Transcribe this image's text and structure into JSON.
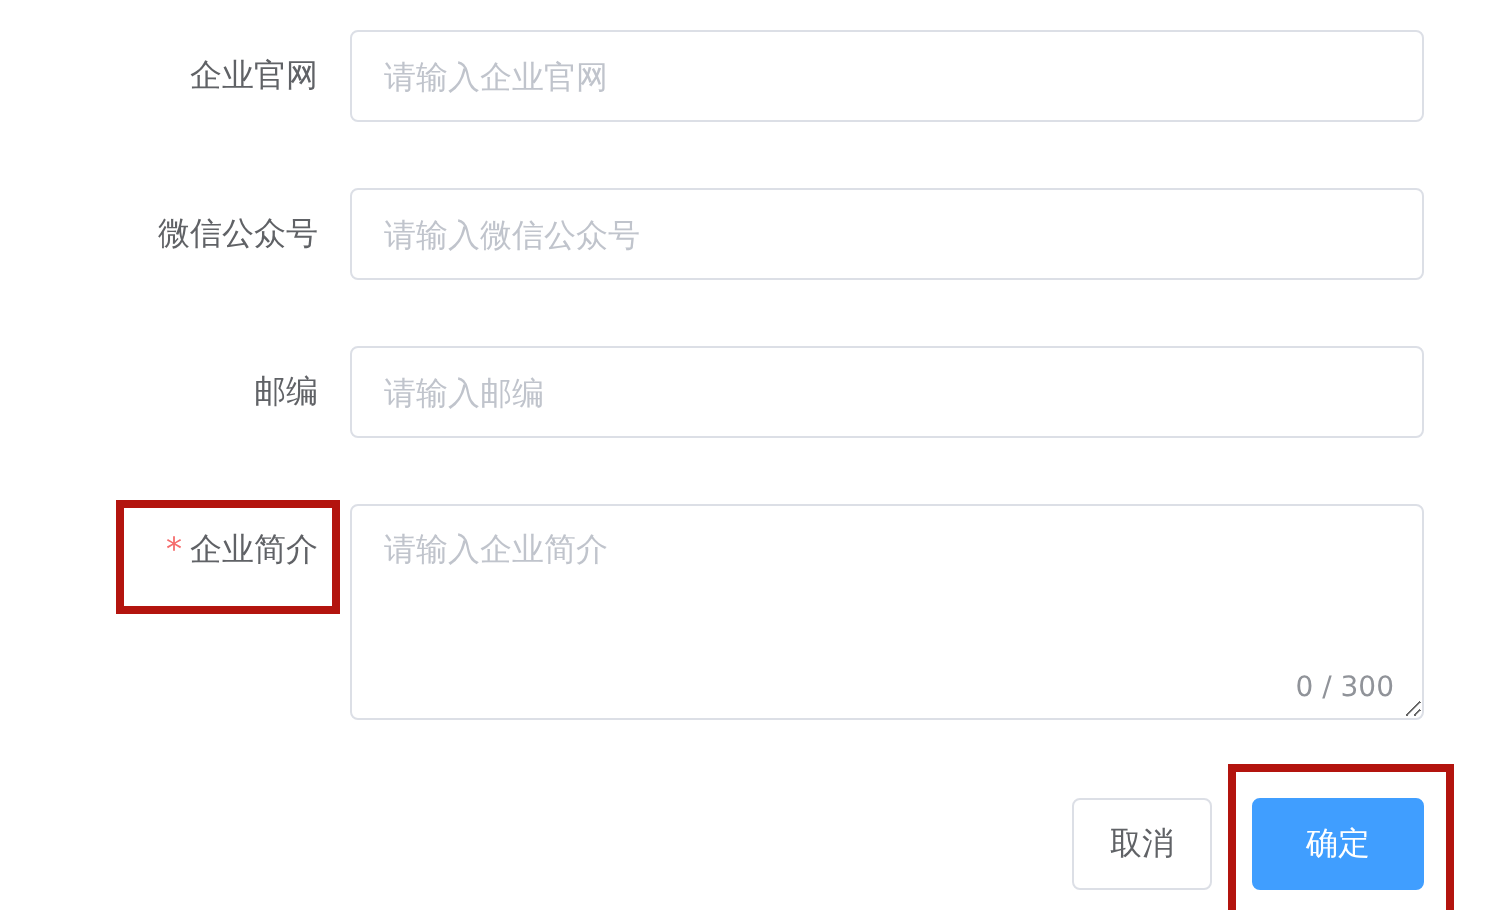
{
  "fields": [
    {
      "kind": "input",
      "label": "企业官网",
      "placeholder": "请输入企业官网",
      "highlighted": false
    },
    {
      "kind": "input",
      "label": "微信公众号",
      "placeholder": "请输入微信公众号",
      "highlighted": false
    },
    {
      "kind": "input",
      "label": "邮编",
      "placeholder": "请输入邮编",
      "highlighted": false
    },
    {
      "kind": "textarea",
      "required_mark": "*",
      "label": "企业简介",
      "placeholder": "请输入企业简介",
      "highlighted": true,
      "counter": "0 / 300"
    }
  ],
  "buttons": [
    {
      "kind": "default",
      "label": "取消",
      "highlighted": false
    },
    {
      "kind": "primary",
      "label": "确定",
      "highlighted": true
    }
  ]
}
